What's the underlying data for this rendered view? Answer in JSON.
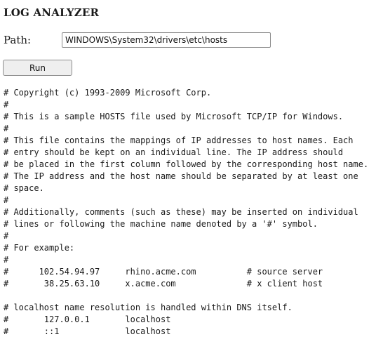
{
  "app": {
    "title": "LOG ANALYZER"
  },
  "form": {
    "path_label": "Path:",
    "path_value": "WINDOWS\\System32\\drivers\\etc\\hosts",
    "run_label": "Run"
  },
  "output": {
    "lines": [
      "# Copyright (c) 1993-2009 Microsoft Corp.",
      "#",
      "# This is a sample HOSTS file used by Microsoft TCP/IP for Windows.",
      "#",
      "# This file contains the mappings of IP addresses to host names. Each",
      "# entry should be kept on an individual line. The IP address should",
      "# be placed in the first column followed by the corresponding host name.",
      "# The IP address and the host name should be separated by at least one",
      "# space.",
      "#",
      "# Additionally, comments (such as these) may be inserted on individual",
      "# lines or following the machine name denoted by a '#' symbol.",
      "#",
      "# For example:",
      "#",
      "#      102.54.94.97     rhino.acme.com          # source server",
      "#       38.25.63.10     x.acme.com              # x client host",
      "",
      "# localhost name resolution is handled within DNS itself.",
      "#       127.0.0.1       localhost",
      "#       ::1             localhost"
    ]
  }
}
